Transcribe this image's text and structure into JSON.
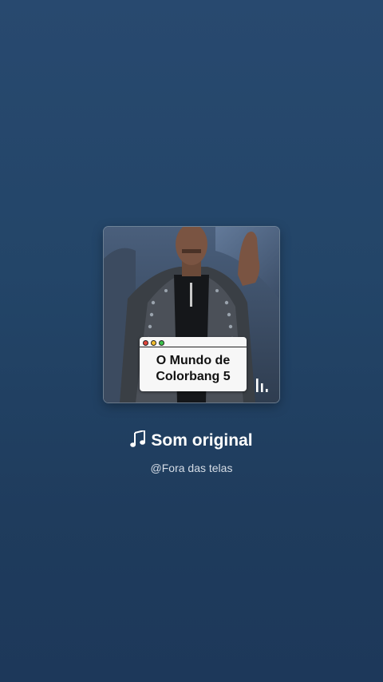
{
  "cover": {
    "caption_line1": "O Mundo de",
    "caption_line2": "Colorbang 5",
    "window_dot_colors": [
      "#e0443a",
      "#f1bd2f",
      "#3cc24b"
    ],
    "playing_icon": "equalizer-bars-icon"
  },
  "sound": {
    "note_icon": "music-note-icon",
    "title": "Som original",
    "author": "@Fora das telas"
  }
}
